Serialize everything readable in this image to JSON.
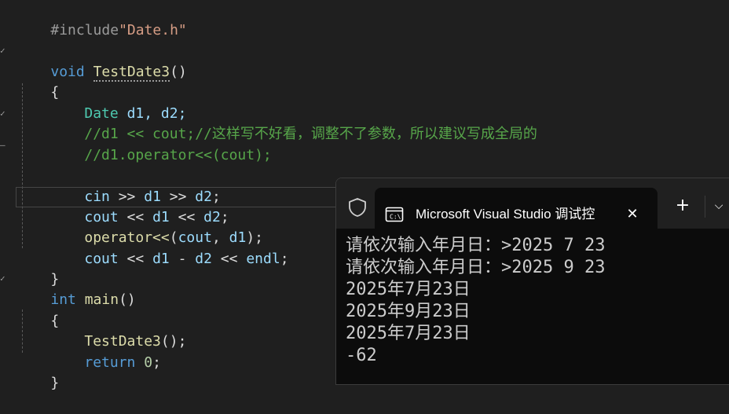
{
  "editor": {
    "include_directive": "#include",
    "include_file": "\"Date.h\"",
    "void_kw": "void",
    "func1_name": "TestDate3",
    "parens": "()",
    "brace_open": "{",
    "brace_close": "}",
    "decl_type": "Date",
    "decl_vars": "d1, d2;",
    "comment1": "//d1 << cout;//这样写不好看，调整不了参数，所以建议写成全局的",
    "comment2": "//d1.operator<<(cout);",
    "cin_line": {
      "cin": "cin",
      "op1": " >> ",
      "v1": "d1",
      "op2": " >> ",
      "v2": "d2",
      "end": ";"
    },
    "cout_line": {
      "cout": "cout",
      "op1": " << ",
      "v1": "d1",
      "op2": " << ",
      "v2": "d2",
      "end": ";"
    },
    "operator_line": {
      "fn": "operator<<",
      "open": "(",
      "a1": "cout",
      "sep": ", ",
      "a2": "d1",
      "close": ");"
    },
    "cout_sub_line": {
      "cout": "cout",
      "op1": " << ",
      "v1": "d1",
      "minus": " - ",
      "v2": "d2",
      "op2": " << ",
      "endl": "endl",
      "end": ";"
    },
    "int_kw": "int",
    "main_name": "main",
    "call_name": "TestDate3",
    "call_end": "();",
    "return_kw": "return",
    "return_val": "0",
    "semicolon": ";"
  },
  "terminal": {
    "tab_title": "Microsoft Visual Studio 调试控",
    "close_label": "✕",
    "new_tab_label": "+",
    "dropdown_label": "⌵",
    "output": [
      "请依次输入年月日：>2025 7 23",
      "请依次输入年月日：>2025 9 23",
      "2025年7月23日",
      "2025年9月23日",
      "2025年7月23日",
      "-62"
    ]
  }
}
